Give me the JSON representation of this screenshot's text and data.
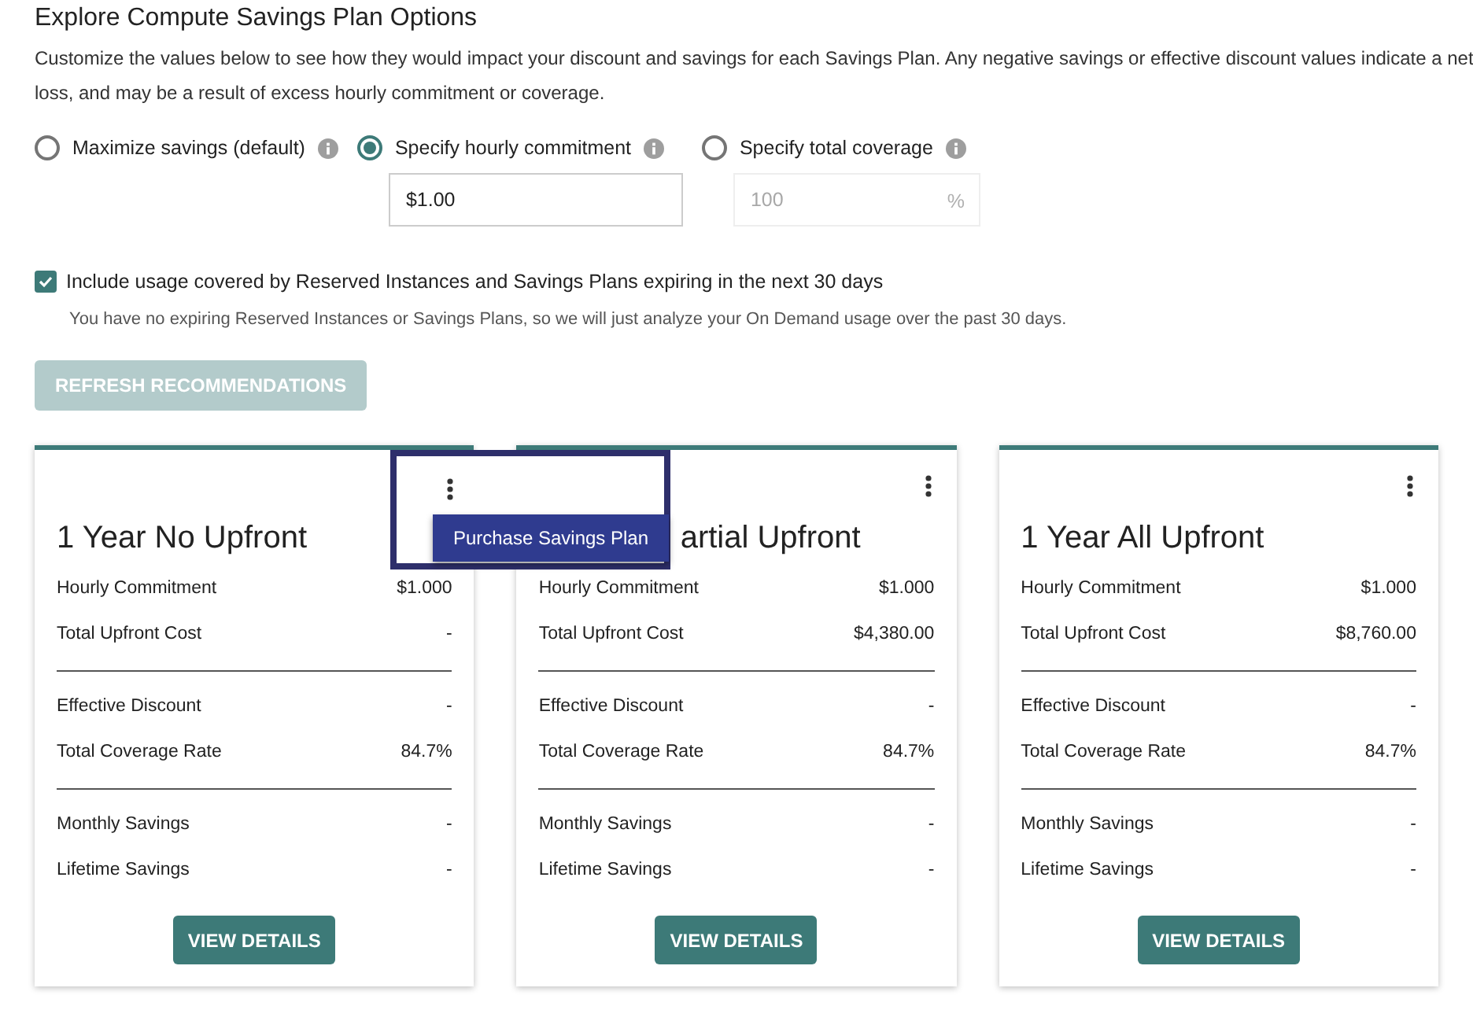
{
  "heading": "Explore Compute Savings Plan Options",
  "description": "Customize the values below to see how they would impact your discount and savings for each Savings Plan. Any negative savings or effective discount values indicate a net loss, and may be a result of excess hourly commitment or coverage.",
  "options": [
    {
      "label": "Maximize savings (default)",
      "selected": false
    },
    {
      "label": "Specify hourly commitment",
      "selected": true,
      "field": {
        "value": "$1.00",
        "disabled": false
      }
    },
    {
      "label": "Specify total coverage",
      "selected": false,
      "field": {
        "placeholder": "100",
        "suffix": "%",
        "disabled": true
      }
    }
  ],
  "include_expiring": {
    "label": "Include usage covered by Reserved Instances and Savings Plans expiring in the next 30 days",
    "checked": true,
    "note": "You have no expiring Reserved Instances or Savings Plans, so we will just analyze your On Demand usage over the past 30 days."
  },
  "refresh_button": {
    "label": "REFRESH RECOMMENDATIONS",
    "disabled": true
  },
  "cards": [
    {
      "title": "1 Year No Upfront",
      "menu_open": true,
      "menu_item": "Purchase Savings Plan",
      "groups": [
        [
          {
            "label": "Hourly Commitment",
            "value": "$1.000"
          },
          {
            "label": "Total Upfront Cost",
            "value": "-"
          }
        ],
        [
          {
            "label": "Effective Discount",
            "value": "-"
          },
          {
            "label": "Total Coverage Rate",
            "value": "84.7%"
          }
        ],
        [
          {
            "label": "Monthly Savings",
            "value": "-"
          },
          {
            "label": "Lifetime Savings",
            "value": "-"
          }
        ]
      ],
      "button": "VIEW DETAILS"
    },
    {
      "title": "artial Upfront",
      "menu_open": false,
      "groups": [
        [
          {
            "label": "Hourly Commitment",
            "value": "$1.000"
          },
          {
            "label": "Total Upfront Cost",
            "value": "$4,380.00"
          }
        ],
        [
          {
            "label": "Effective Discount",
            "value": "-"
          },
          {
            "label": "Total Coverage Rate",
            "value": "84.7%"
          }
        ],
        [
          {
            "label": "Monthly Savings",
            "value": "-"
          },
          {
            "label": "Lifetime Savings",
            "value": "-"
          }
        ]
      ],
      "button": "VIEW DETAILS"
    },
    {
      "title": "1 Year All Upfront",
      "menu_open": false,
      "groups": [
        [
          {
            "label": "Hourly Commitment",
            "value": "$1.000"
          },
          {
            "label": "Total Upfront Cost",
            "value": "$8,760.00"
          }
        ],
        [
          {
            "label": "Effective Discount",
            "value": "-"
          },
          {
            "label": "Total Coverage Rate",
            "value": "84.7%"
          }
        ],
        [
          {
            "label": "Monthly Savings",
            "value": "-"
          },
          {
            "label": "Lifetime Savings",
            "value": "-"
          }
        ]
      ],
      "button": "VIEW DETAILS"
    }
  ]
}
